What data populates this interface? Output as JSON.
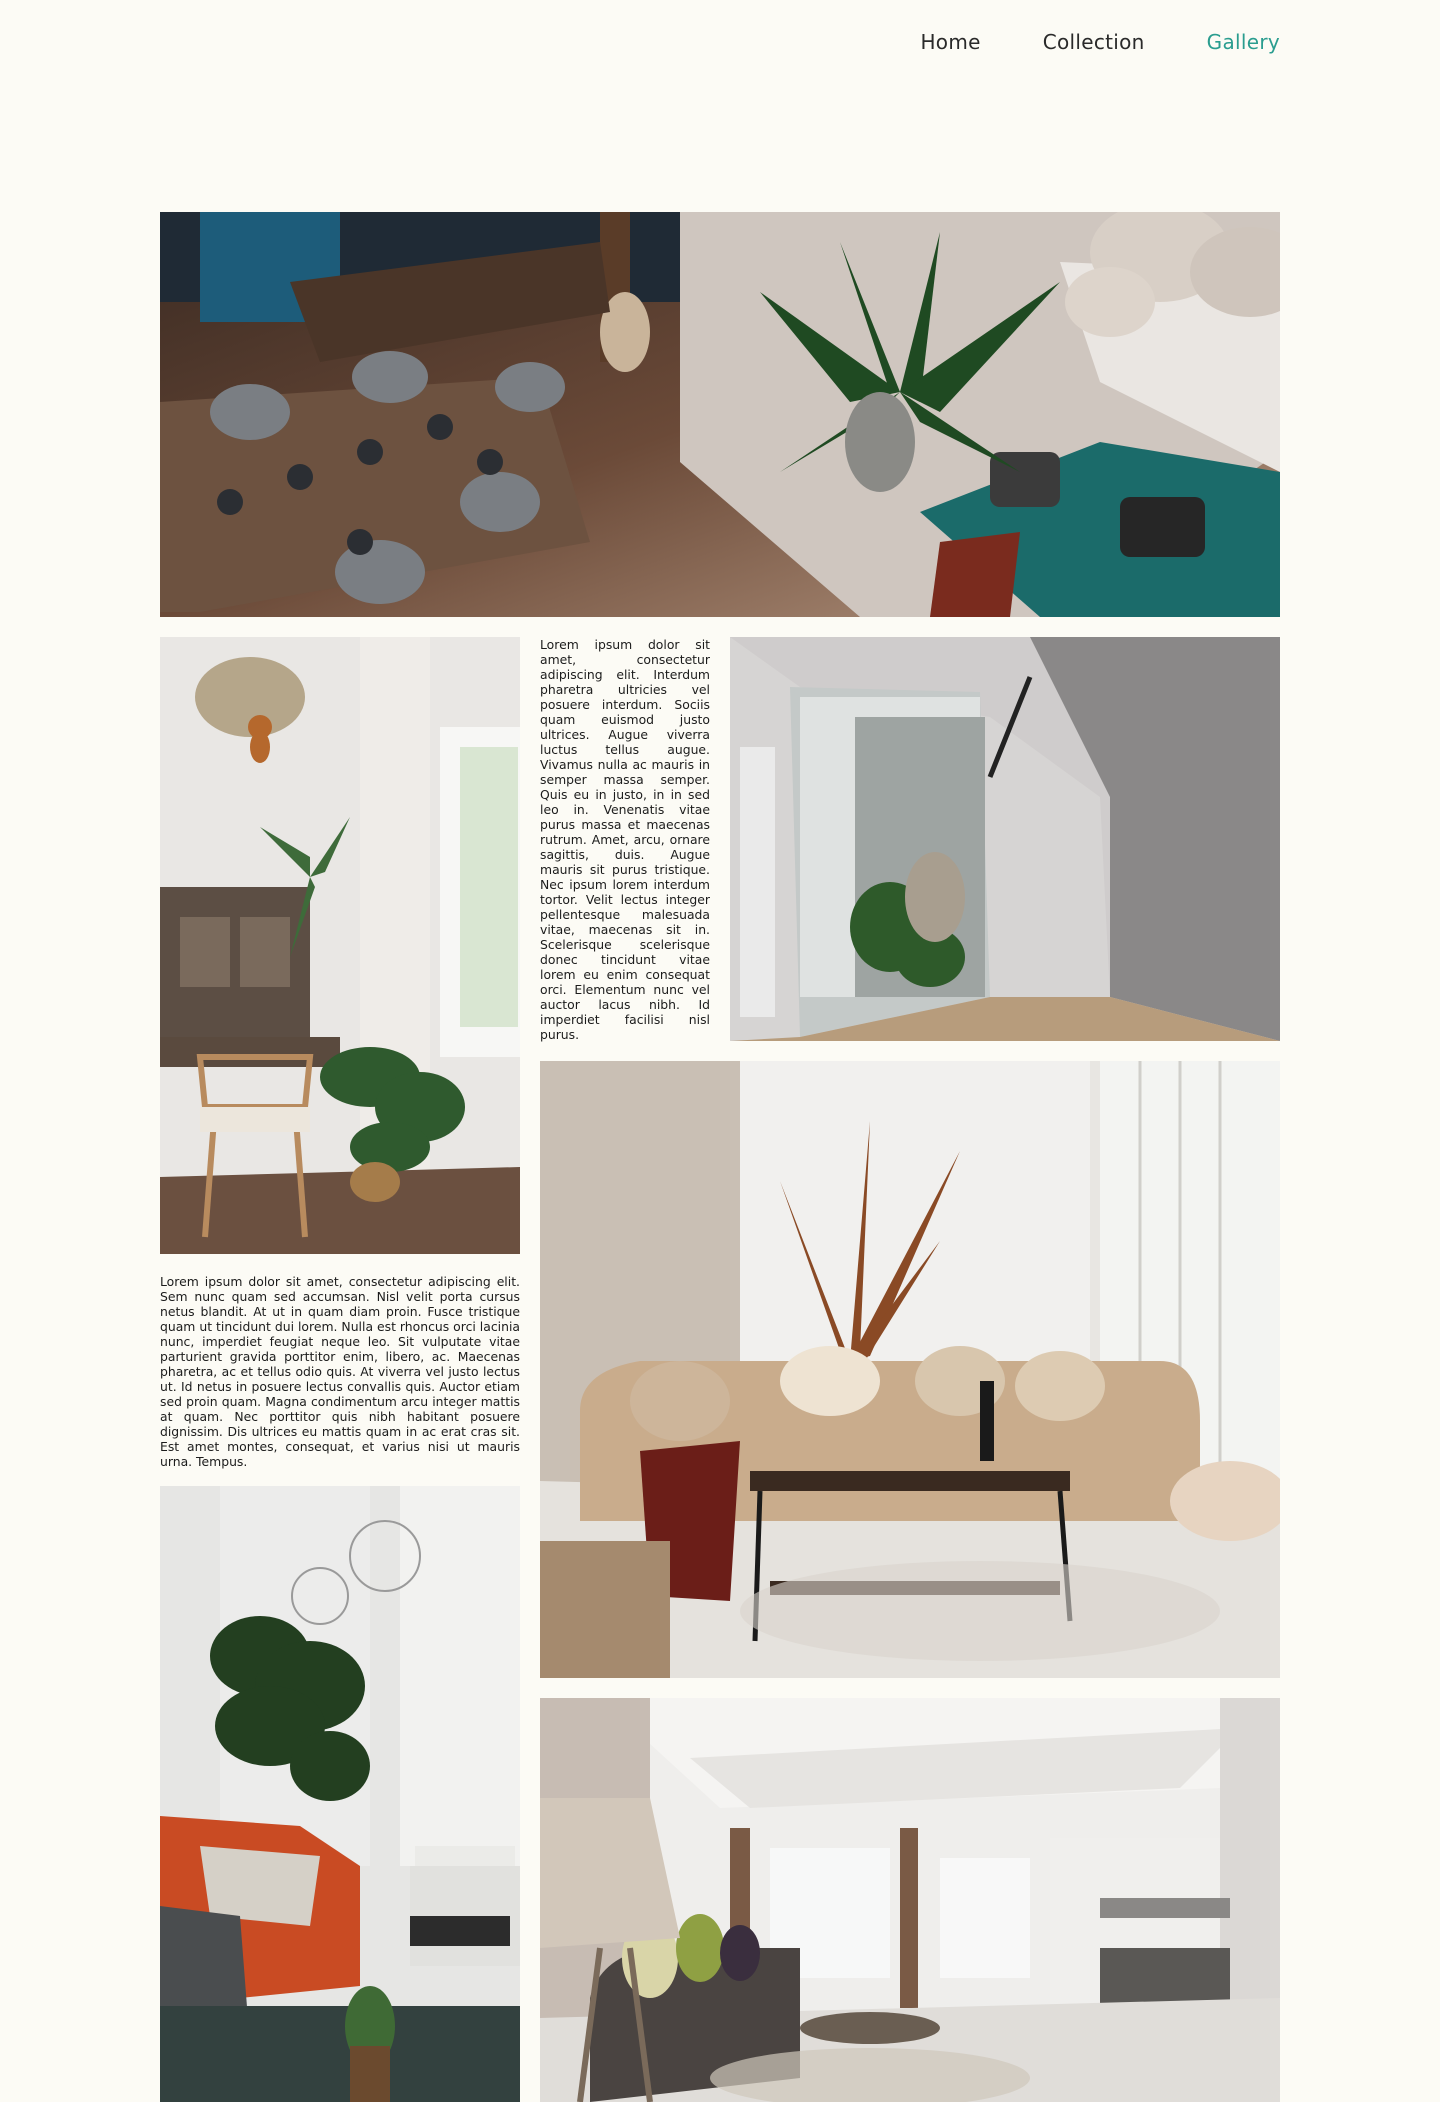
{
  "nav": {
    "items": [
      {
        "label": "Home",
        "active": false
      },
      {
        "label": "Collection",
        "active": false
      },
      {
        "label": "Gallery",
        "active": true
      }
    ],
    "active_color": "#2a9d8f"
  },
  "gallery": {
    "text_block_1": "Lorem ipsum dolor sit amet, consectetur adipiscing elit. Interdum pharetra ultricies vel posuere interdum. Sociis quam euismod justo ultrices. Augue viverra luctus tellus augue. Vivamus nulla ac mauris in semper massa semper. Quis eu in justo, in in sed leo in. Venenatis vitae purus massa et maecenas rutrum. Amet, arcu, ornare sagittis, duis. Augue mauris sit purus tristique. Nec ipsum lorem interdum tortor. Velit lectus integer pellentesque malesuada vitae, maecenas sit in. Scelerisque scelerisque donec tincidunt vitae lorem eu enim consequat orci. Elementum nunc vel auctor lacus nibh. Id imperdiet facilisi nisl purus.",
    "text_block_2": "Lorem ipsum dolor sit amet, consectetur adipiscing elit. Sem nunc quam sed accumsan. Nisl velit porta cursus netus blandit. At ut in quam diam proin. Fusce tristique quam ut tincidunt dui lorem. Nulla est rhoncus orci lacinia nunc, imperdiet feugiat neque leo. Sit vulputate vitae parturient gravida porttitor enim, libero, ac. Maecenas pharetra, ac et tellus odio quis. At viverra vel justo lectus ut. Id netus in posuere lectus convallis quis. Auctor etiam sed proin quam. Magna condimentum arcu integer mattis at quam. Nec porttitor quis nibh habitant posuere dignissim. Dis ultrices eu mattis quam in ac erat cras sit. Est amet montes, consequat, et varius nisi ut mauris urna. Tempus."
  }
}
